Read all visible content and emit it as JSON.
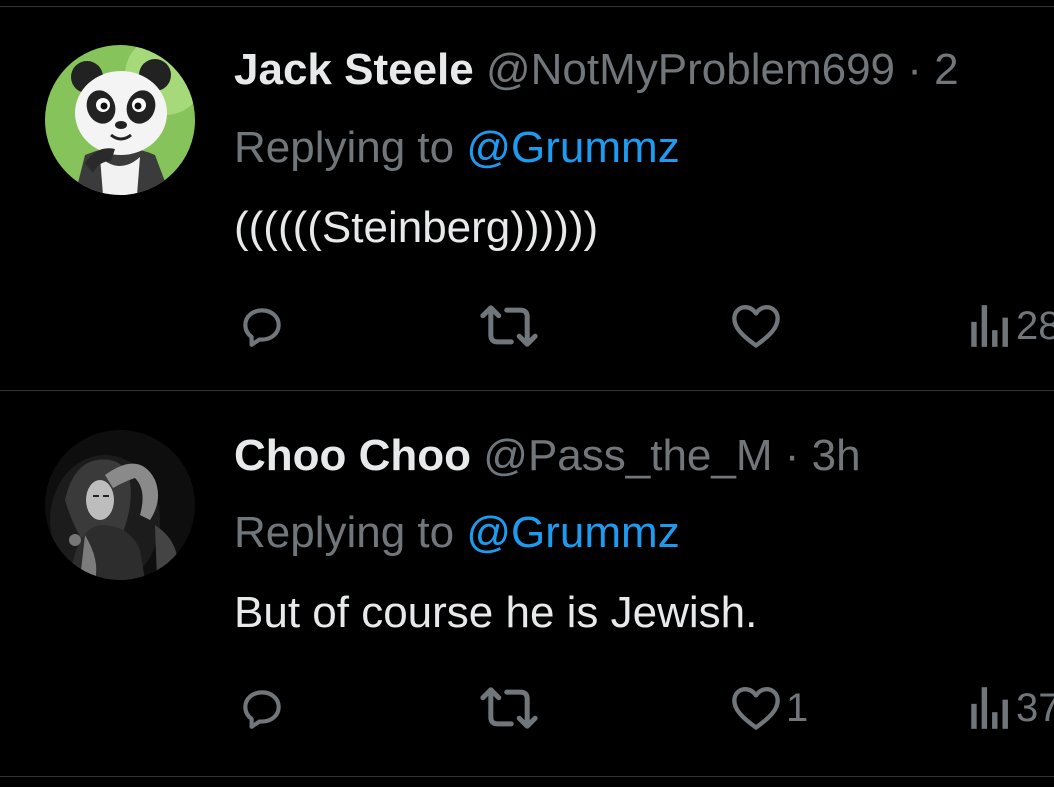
{
  "tweets": [
    {
      "name": "Jack Steele",
      "handle": "@NotMyProblem699",
      "separator": "·",
      "time": "2",
      "replying_prefix": "Replying to",
      "replying_to": "@Grummz",
      "body": "((((((Steinberg))))))",
      "actions": {
        "reply_count": "",
        "retweet_count": "",
        "like_count": "",
        "views_count": "28"
      },
      "avatar_icon": "panda-avatar-icon"
    },
    {
      "name": "Choo Choo",
      "handle": "@Pass_the_M",
      "separator": "·",
      "time": "3h",
      "replying_prefix": "Replying to",
      "replying_to": "@Grummz",
      "body": "But of course he is Jewish.",
      "actions": {
        "reply_count": "",
        "retweet_count": "",
        "like_count": "1",
        "views_count": "37"
      },
      "avatar_icon": "bw-photo-avatar-icon"
    }
  ],
  "colors": {
    "background": "#000000",
    "primary_text": "#e7e9ea",
    "secondary_text": "#71767b",
    "link": "#1d9bf0",
    "divider": "#2f3336"
  },
  "icons": [
    "reply-icon",
    "retweet-icon",
    "like-icon",
    "views-icon"
  ]
}
